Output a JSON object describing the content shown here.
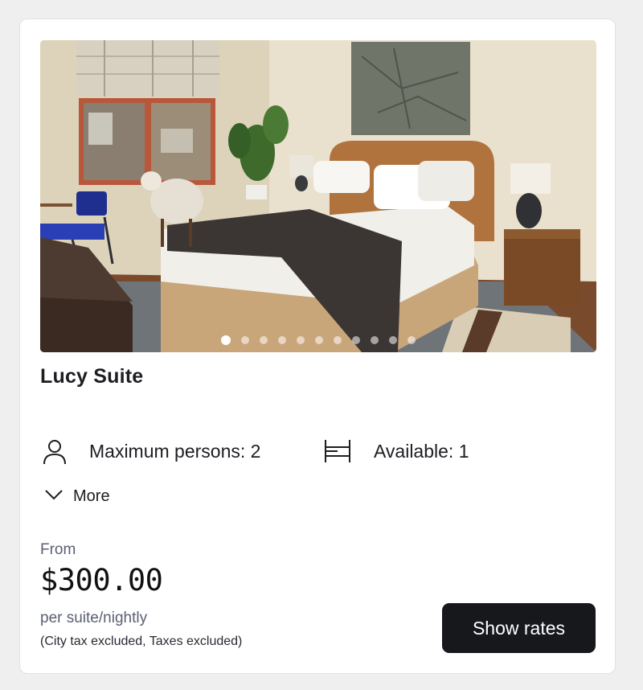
{
  "room": {
    "title": "Lucy Suite",
    "image_alt": "Bedroom with bed, window, plant and artwork"
  },
  "carousel": {
    "dot_count": 11,
    "active_index": 0
  },
  "features": {
    "persons_label": "Maximum persons: 2",
    "available_label": "Available: 1"
  },
  "more": {
    "label": "More"
  },
  "pricing": {
    "from_label": "From",
    "price": "$300.00",
    "unit": "per suite/nightly",
    "tax_note": "(City tax excluded, Taxes excluded)"
  },
  "actions": {
    "show_rates_label": "Show rates"
  },
  "colors": {
    "page_bg": "#efeff0",
    "card_bg": "#ffffff",
    "button_bg": "#16181b",
    "muted_text": "#5a5f73"
  },
  "icons": [
    "person-icon",
    "bed-icon",
    "chevron-down-icon"
  ]
}
